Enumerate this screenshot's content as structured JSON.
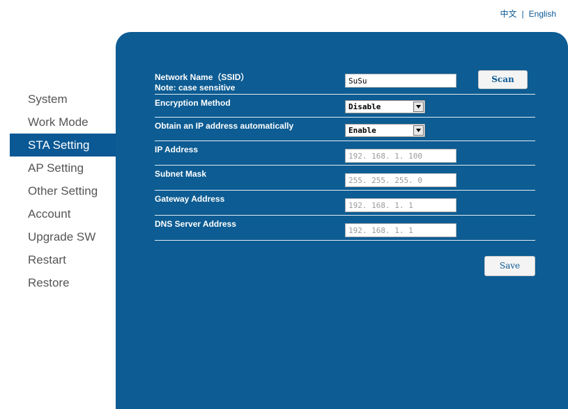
{
  "language_bar": {
    "chinese": "中文",
    "separator": "|",
    "english": "English"
  },
  "sidebar": {
    "items": [
      {
        "label": "System"
      },
      {
        "label": "Work Mode"
      },
      {
        "label": "STA Setting"
      },
      {
        "label": "AP Setting"
      },
      {
        "label": "Other Setting"
      },
      {
        "label": "Account"
      },
      {
        "label": "Upgrade SW"
      },
      {
        "label": "Restart"
      },
      {
        "label": "Restore"
      }
    ],
    "active": "STA Setting"
  },
  "form": {
    "ssid": {
      "label": "Network Name（SSID）",
      "note": "Note: case sensitive",
      "value": "SuSu",
      "scan_label": "Scan"
    },
    "encryption": {
      "label": "Encryption Method",
      "value": "Disable"
    },
    "dhcp": {
      "label": "Obtain an IP address automatically",
      "value": "Enable"
    },
    "ip": {
      "label": "IP Address",
      "value": "192. 168. 1. 100"
    },
    "subnet": {
      "label": "Subnet Mask",
      "value": "255. 255. 255. 0"
    },
    "gateway": {
      "label": "Gateway Address",
      "value": "192. 168. 1. 1"
    },
    "dns": {
      "label": "DNS Server Address",
      "value": "192. 168. 1. 1"
    },
    "save_label": "Save"
  },
  "colors": {
    "panel": "#0d5c93",
    "active_nav": "#0a5894",
    "link": "#0a5894"
  }
}
